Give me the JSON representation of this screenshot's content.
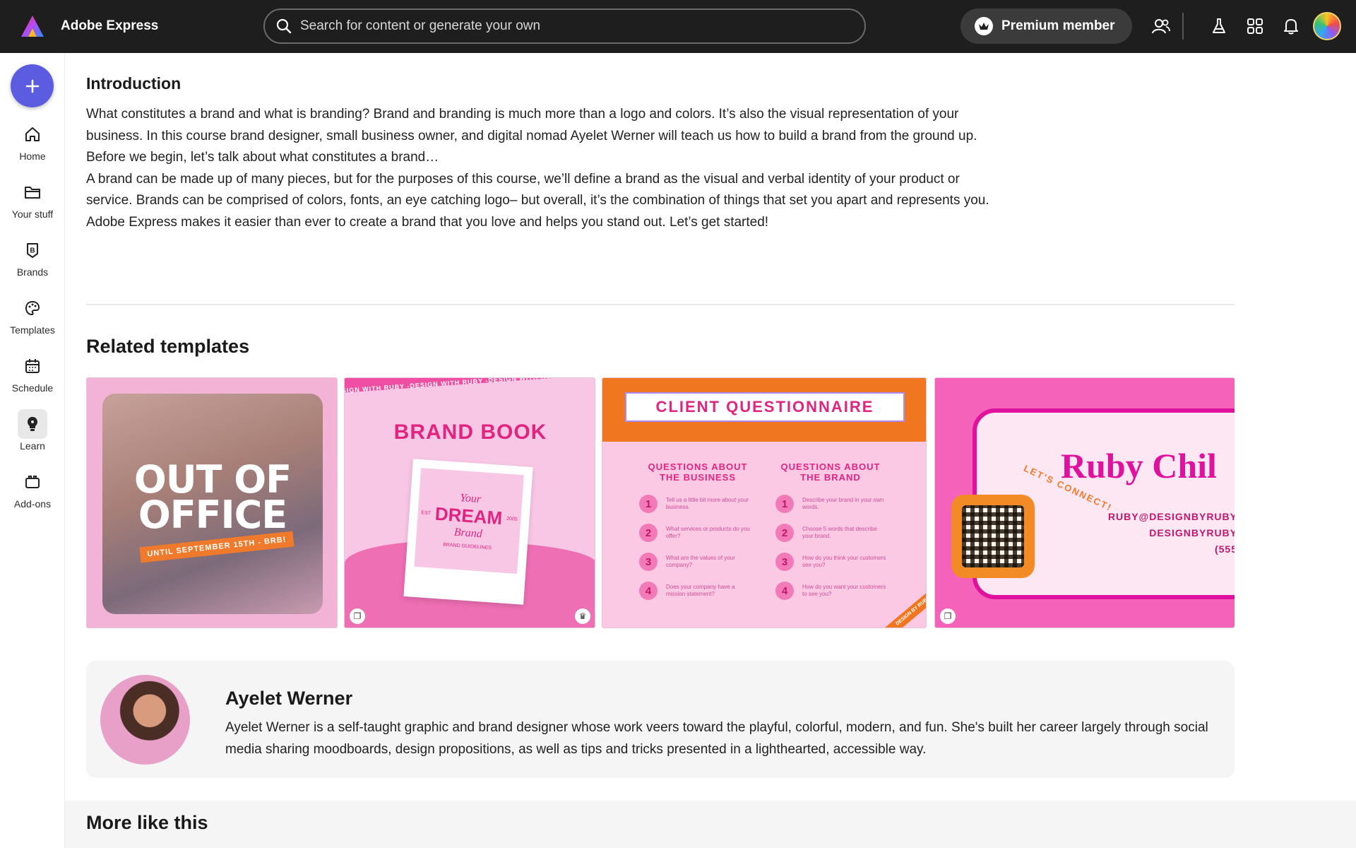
{
  "app": {
    "title": "Adobe Express"
  },
  "search": {
    "placeholder": "Search for content or generate your own"
  },
  "header": {
    "premium_label": "Premium member"
  },
  "rail": {
    "create_label": "+",
    "items": [
      {
        "label": "Home",
        "icon": "home-icon"
      },
      {
        "label": "Your stuff",
        "icon": "folder-icon"
      },
      {
        "label": "Brands",
        "icon": "brand-icon"
      },
      {
        "label": "Templates",
        "icon": "templates-icon"
      },
      {
        "label": "Schedule",
        "icon": "calendar-icon"
      },
      {
        "label": "Learn",
        "icon": "lightbulb-icon",
        "active": true
      },
      {
        "label": "Add-ons",
        "icon": "addons-icon"
      }
    ]
  },
  "intro": {
    "heading": "Introduction",
    "paragraphs": [
      "What constitutes a brand and what is branding? Brand and branding is much more than a logo and colors. It’s also the visual representation of your business. In this course brand designer, small business owner, and digital nomad Ayelet Werner will teach us how to build a brand from the ground up.",
      "Before we begin, let’s talk about what constitutes a brand…",
      "A brand can be made up of many pieces, but for the purposes of this course, we’ll define a brand as the visual and verbal identity of your product or service. Brands can be comprised of colors, fonts, an eye catching logo– but overall, it’s the combination of things that set you apart and represents you.",
      "Adobe Express makes it easier than ever to create a brand that you love and helps you stand out. Let’s get started!"
    ]
  },
  "related": {
    "heading": "Related templates",
    "templates": [
      {
        "name": "out-of-office",
        "line1": "OUT OF",
        "line2": "OFFICE",
        "ribbon": "UNTIL SEPTEMBER 15TH - BRB!"
      },
      {
        "name": "brand-book",
        "band": "DESIGN WITH RUBY -DESIGN WITH RUBY -DESIGN WITH RUBY -DESIGN W",
        "title": "BRAND BOOK",
        "polaroid_your": "Your",
        "polaroid_dream": "DREAM",
        "polaroid_brand": "Brand",
        "polaroid_est": "EST",
        "polaroid_year": "2005",
        "polaroid_sub": "BRAND GUIDELINES"
      },
      {
        "name": "client-questionnaire",
        "title": "CLIENT QUESTIONNAIRE",
        "col1_heading": "QUESTIONS ABOUT THE BUSINESS",
        "col2_heading": "QUESTIONS ABOUT THE BRAND",
        "col1": [
          {
            "n": "1",
            "t": "Tell us a little bit more about your business."
          },
          {
            "n": "2",
            "t": "What services or products do you offer?"
          },
          {
            "n": "3",
            "t": "What are the values of your company?"
          },
          {
            "n": "4",
            "t": "Does your company have a mission statement?"
          }
        ],
        "col2": [
          {
            "n": "1",
            "t": "Describe your brand in your own words."
          },
          {
            "n": "2",
            "t": "Choose 5 words that describe your brand."
          },
          {
            "n": "3",
            "t": "How do you think your customers see you?"
          },
          {
            "n": "4",
            "t": "How do you want your customers to see you?"
          }
        ],
        "corner": "DESIGN BY RUBY"
      },
      {
        "name": "business-card",
        "title": "Ruby Chil",
        "connect": "LET'S CONNECT!",
        "email": "RUBY@DESIGNBYRUBY",
        "site": "DESIGNBYRUBY",
        "phone": "(555"
      }
    ]
  },
  "author": {
    "name": "Ayelet Werner",
    "bio": "Ayelet Werner is a self-taught graphic and brand designer whose work veers toward the playful, colorful, modern, and fun. She's built her career largely through social media sharing moodboards, design propositions, as well as tips and tricks presented in a lighthearted, accessible way."
  },
  "more": {
    "heading": "More like this"
  },
  "colors": {
    "topbar": "#1e1e1e",
    "accent": "#5c5ce0",
    "pink": "#e0247f",
    "orange": "#f0761f"
  }
}
